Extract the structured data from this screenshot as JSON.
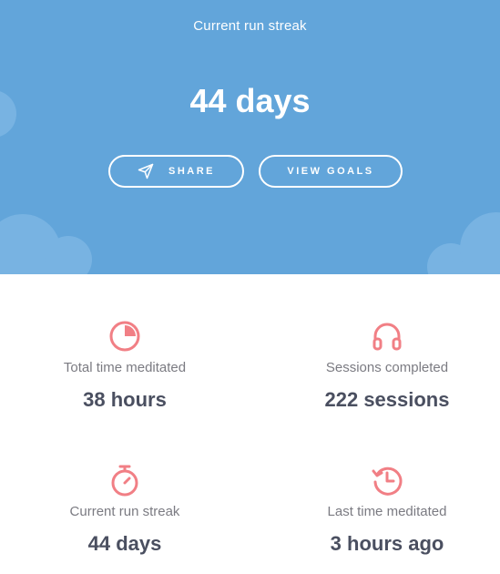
{
  "hero": {
    "label": "Current run streak",
    "value": "44 days",
    "share_label": "SHARE",
    "goals_label": "VIEW GOALS",
    "background_color": "#62a5da"
  },
  "stats": {
    "total_time": {
      "label": "Total time meditated",
      "value": "38 hours",
      "icon": "pie-chart-icon"
    },
    "sessions": {
      "label": "Sessions completed",
      "value": "222 sessions",
      "icon": "headphones-icon"
    },
    "streak": {
      "label": "Current run streak",
      "value": "44 days",
      "icon": "stopwatch-icon"
    },
    "last_time": {
      "label": "Last time meditated",
      "value": "3 hours ago",
      "icon": "history-clock-icon"
    }
  },
  "colors": {
    "accent": "#f17f85",
    "label": "#7b7b82",
    "value": "#4a4f60"
  }
}
